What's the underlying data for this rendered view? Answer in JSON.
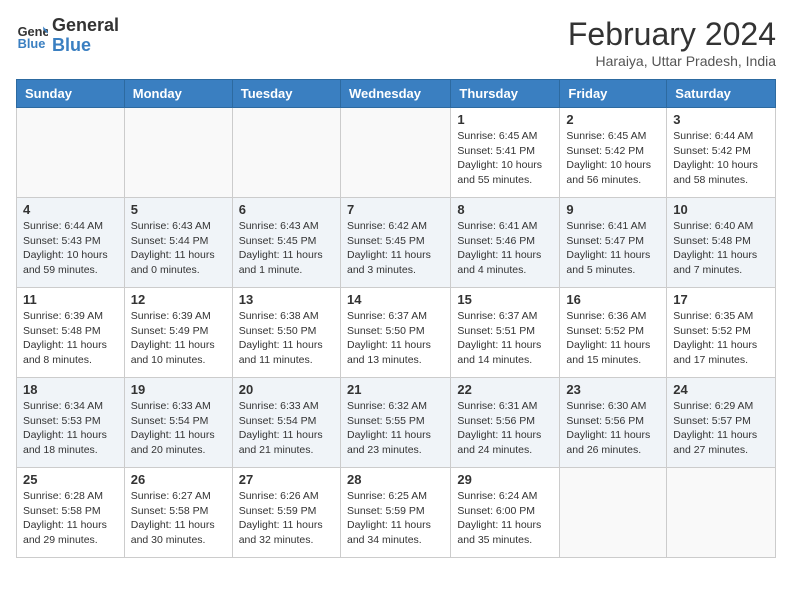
{
  "logo": {
    "line1": "General",
    "line2": "Blue"
  },
  "title": "February 2024",
  "location": "Haraiya, Uttar Pradesh, India",
  "days_of_week": [
    "Sunday",
    "Monday",
    "Tuesday",
    "Wednesday",
    "Thursday",
    "Friday",
    "Saturday"
  ],
  "weeks": [
    [
      {
        "day": "",
        "info": ""
      },
      {
        "day": "",
        "info": ""
      },
      {
        "day": "",
        "info": ""
      },
      {
        "day": "",
        "info": ""
      },
      {
        "day": "1",
        "info": "Sunrise: 6:45 AM\nSunset: 5:41 PM\nDaylight: 10 hours and 55 minutes."
      },
      {
        "day": "2",
        "info": "Sunrise: 6:45 AM\nSunset: 5:42 PM\nDaylight: 10 hours and 56 minutes."
      },
      {
        "day": "3",
        "info": "Sunrise: 6:44 AM\nSunset: 5:42 PM\nDaylight: 10 hours and 58 minutes."
      }
    ],
    [
      {
        "day": "4",
        "info": "Sunrise: 6:44 AM\nSunset: 5:43 PM\nDaylight: 10 hours and 59 minutes."
      },
      {
        "day": "5",
        "info": "Sunrise: 6:43 AM\nSunset: 5:44 PM\nDaylight: 11 hours and 0 minutes."
      },
      {
        "day": "6",
        "info": "Sunrise: 6:43 AM\nSunset: 5:45 PM\nDaylight: 11 hours and 1 minute."
      },
      {
        "day": "7",
        "info": "Sunrise: 6:42 AM\nSunset: 5:45 PM\nDaylight: 11 hours and 3 minutes."
      },
      {
        "day": "8",
        "info": "Sunrise: 6:41 AM\nSunset: 5:46 PM\nDaylight: 11 hours and 4 minutes."
      },
      {
        "day": "9",
        "info": "Sunrise: 6:41 AM\nSunset: 5:47 PM\nDaylight: 11 hours and 5 minutes."
      },
      {
        "day": "10",
        "info": "Sunrise: 6:40 AM\nSunset: 5:48 PM\nDaylight: 11 hours and 7 minutes."
      }
    ],
    [
      {
        "day": "11",
        "info": "Sunrise: 6:39 AM\nSunset: 5:48 PM\nDaylight: 11 hours and 8 minutes."
      },
      {
        "day": "12",
        "info": "Sunrise: 6:39 AM\nSunset: 5:49 PM\nDaylight: 11 hours and 10 minutes."
      },
      {
        "day": "13",
        "info": "Sunrise: 6:38 AM\nSunset: 5:50 PM\nDaylight: 11 hours and 11 minutes."
      },
      {
        "day": "14",
        "info": "Sunrise: 6:37 AM\nSunset: 5:50 PM\nDaylight: 11 hours and 13 minutes."
      },
      {
        "day": "15",
        "info": "Sunrise: 6:37 AM\nSunset: 5:51 PM\nDaylight: 11 hours and 14 minutes."
      },
      {
        "day": "16",
        "info": "Sunrise: 6:36 AM\nSunset: 5:52 PM\nDaylight: 11 hours and 15 minutes."
      },
      {
        "day": "17",
        "info": "Sunrise: 6:35 AM\nSunset: 5:52 PM\nDaylight: 11 hours and 17 minutes."
      }
    ],
    [
      {
        "day": "18",
        "info": "Sunrise: 6:34 AM\nSunset: 5:53 PM\nDaylight: 11 hours and 18 minutes."
      },
      {
        "day": "19",
        "info": "Sunrise: 6:33 AM\nSunset: 5:54 PM\nDaylight: 11 hours and 20 minutes."
      },
      {
        "day": "20",
        "info": "Sunrise: 6:33 AM\nSunset: 5:54 PM\nDaylight: 11 hours and 21 minutes."
      },
      {
        "day": "21",
        "info": "Sunrise: 6:32 AM\nSunset: 5:55 PM\nDaylight: 11 hours and 23 minutes."
      },
      {
        "day": "22",
        "info": "Sunrise: 6:31 AM\nSunset: 5:56 PM\nDaylight: 11 hours and 24 minutes."
      },
      {
        "day": "23",
        "info": "Sunrise: 6:30 AM\nSunset: 5:56 PM\nDaylight: 11 hours and 26 minutes."
      },
      {
        "day": "24",
        "info": "Sunrise: 6:29 AM\nSunset: 5:57 PM\nDaylight: 11 hours and 27 minutes."
      }
    ],
    [
      {
        "day": "25",
        "info": "Sunrise: 6:28 AM\nSunset: 5:58 PM\nDaylight: 11 hours and 29 minutes."
      },
      {
        "day": "26",
        "info": "Sunrise: 6:27 AM\nSunset: 5:58 PM\nDaylight: 11 hours and 30 minutes."
      },
      {
        "day": "27",
        "info": "Sunrise: 6:26 AM\nSunset: 5:59 PM\nDaylight: 11 hours and 32 minutes."
      },
      {
        "day": "28",
        "info": "Sunrise: 6:25 AM\nSunset: 5:59 PM\nDaylight: 11 hours and 34 minutes."
      },
      {
        "day": "29",
        "info": "Sunrise: 6:24 AM\nSunset: 6:00 PM\nDaylight: 11 hours and 35 minutes."
      },
      {
        "day": "",
        "info": ""
      },
      {
        "day": "",
        "info": ""
      }
    ]
  ]
}
